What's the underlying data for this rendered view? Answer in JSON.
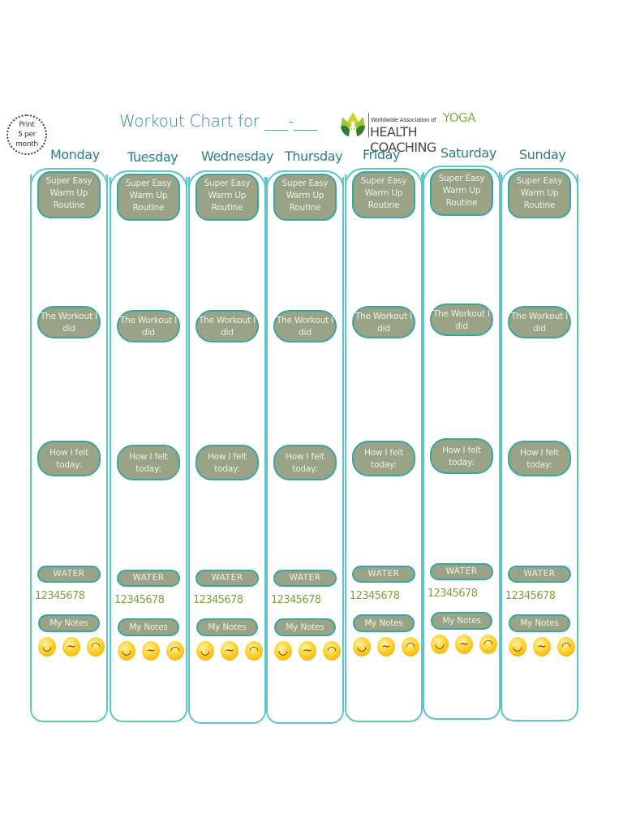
{
  "print_badge": {
    "lines": [
      "Print",
      "5 per",
      "month"
    ]
  },
  "title": "Workout Chart for ___-___",
  "logo": {
    "small_text": "Worldwide Association of",
    "yoga_text": "YOGA",
    "main_text": "HEALTH COACHING",
    "colors": {
      "leaf_light": "#c9d62d",
      "leaf_dark": "#2e7d32",
      "figure": "#ffffff"
    }
  },
  "colors": {
    "accent_teal": "#5ec6c8",
    "pill_fill": "#9aa385",
    "pill_border": "#3aa6a4",
    "title": "#2a8f92",
    "count_green": "#7aa63a"
  },
  "section_labels": {
    "warm_up": "Super Easy Warm Up Routine",
    "workout": "The Workout I did",
    "felt": "How I felt today:",
    "water": "WATER",
    "water_count": "12345678",
    "notes": "My Notes"
  },
  "faces": [
    {
      "name": "happy-face-icon",
      "glyph": "◡"
    },
    {
      "name": "neutral-face-icon",
      "glyph": "~"
    },
    {
      "name": "sad-face-icon",
      "glyph": "◠"
    }
  ],
  "days": [
    {
      "name": "Monday"
    },
    {
      "name": "Tuesday"
    },
    {
      "name": "Wednesday"
    },
    {
      "name": "Thursday"
    },
    {
      "name": "Friday"
    },
    {
      "name": "Saturday"
    },
    {
      "name": "Sunday"
    }
  ]
}
